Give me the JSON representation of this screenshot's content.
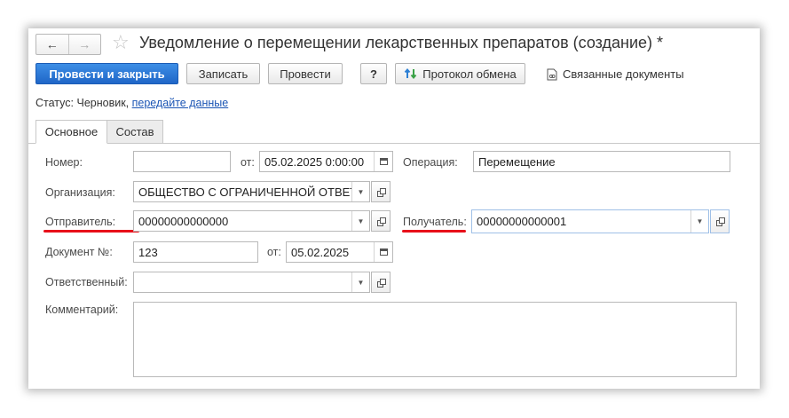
{
  "header": {
    "back_icon": "←",
    "forward_icon": "→",
    "star_icon": "☆",
    "title": "Уведомление о перемещении лекарственных препаратов (создание) *"
  },
  "toolbar": {
    "post_close_label": "Провести и закрыть",
    "save_label": "Записать",
    "post_label": "Провести",
    "help_label": "?",
    "exchange_log_label": "Протокол обмена",
    "related_docs_label": "Связанные документы"
  },
  "status": {
    "prefix": "Статус:",
    "state": "Черновик,",
    "link": "передайте данные"
  },
  "tabs": [
    {
      "label": "Основное",
      "active": true
    },
    {
      "label": "Состав",
      "active": false
    }
  ],
  "form": {
    "number_label": "Номер:",
    "number_value": "",
    "from_label": "от:",
    "date_value": "05.02.2025  0:00:00",
    "operation_label": "Операция:",
    "operation_value": "Перемещение",
    "organization_label": "Организация:",
    "organization_value": "ОБЩЕСТВО С ОГРАНИЧЕННОЙ ОТВЕТСТВЕННОСТЬЮ",
    "sender_label": "Отправитель:",
    "sender_value": "00000000000000",
    "receiver_label": "Получатель:",
    "receiver_value": "00000000000001",
    "doc_number_label": "Документ №:",
    "doc_number_value": "123",
    "doc_from_label": "от:",
    "doc_date_value": "05.02.2025",
    "responsible_label": "Ответственный:",
    "responsible_value": "",
    "comment_label": "Комментарий:",
    "comment_value": ""
  },
  "colors": {
    "primary": "#2a75d6",
    "link": "#1b55b4",
    "highlight": "#e8101a"
  }
}
